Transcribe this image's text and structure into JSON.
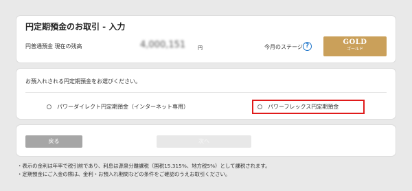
{
  "header": {
    "title": "円定期預金のお取引 - 入力",
    "balance_label": "円普通預金 現在の残高",
    "balance_value": "4,000,151",
    "balance_unit": "円",
    "stage_label": "今月のステージ",
    "help_icon": "?",
    "stage_badge": {
      "label": "GOLD",
      "sublabel": "ゴールド",
      "color": "#caa05a"
    }
  },
  "selection": {
    "prompt": "お預入れされる円定期預金をお選びください。",
    "options": [
      {
        "label": "パワーダイレクト円定期預金（インターネット専用）",
        "highlighted": false
      },
      {
        "label": "パワーフレックス円定期預金",
        "highlighted": true
      }
    ],
    "highlight_color": "#e01a1a"
  },
  "buttons": {
    "back_label": "戻る",
    "next_label": "次へ"
  },
  "notes": [
    "・表示の金利は年率で税引前であり、利息は源泉分離課税（国税15.315%、地方税5%）として課税されます。",
    "・定期預金にご入金の際は、金利・お預入れ期間などの条件をご確認のうえお取引ください。"
  ]
}
